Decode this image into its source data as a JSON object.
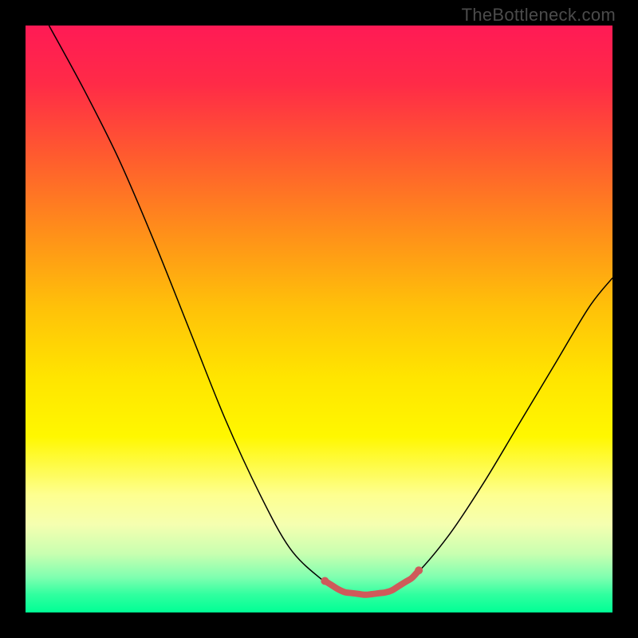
{
  "watermark": "TheBottleneck.com",
  "chart_data": {
    "type": "line",
    "title": "",
    "xlabel": "",
    "ylabel": "",
    "xlim": [
      0,
      1
    ],
    "ylim": [
      0,
      1
    ],
    "series": [
      {
        "name": "bottleneck-curve",
        "points": [
          {
            "x": 0.04,
            "y": 1.0
          },
          {
            "x": 0.1,
            "y": 0.89
          },
          {
            "x": 0.16,
            "y": 0.77
          },
          {
            "x": 0.22,
            "y": 0.63
          },
          {
            "x": 0.28,
            "y": 0.48
          },
          {
            "x": 0.34,
            "y": 0.33
          },
          {
            "x": 0.4,
            "y": 0.2
          },
          {
            "x": 0.45,
            "y": 0.11
          },
          {
            "x": 0.5,
            "y": 0.06
          },
          {
            "x": 0.54,
            "y": 0.035
          },
          {
            "x": 0.58,
            "y": 0.03
          },
          {
            "x": 0.62,
            "y": 0.035
          },
          {
            "x": 0.66,
            "y": 0.06
          },
          {
            "x": 0.72,
            "y": 0.13
          },
          {
            "x": 0.78,
            "y": 0.22
          },
          {
            "x": 0.84,
            "y": 0.32
          },
          {
            "x": 0.9,
            "y": 0.42
          },
          {
            "x": 0.96,
            "y": 0.52
          },
          {
            "x": 1.0,
            "y": 0.57
          }
        ]
      }
    ],
    "highlight": {
      "name": "optimal-range",
      "x_start": 0.51,
      "x_end": 0.67,
      "dot_xs": [
        0.51,
        0.67
      ]
    },
    "background_gradient": {
      "stops": [
        {
          "pos": 0.0,
          "color": "#ff1a55"
        },
        {
          "pos": 0.5,
          "color": "#ffd400"
        },
        {
          "pos": 0.85,
          "color": "#f5ffb0"
        },
        {
          "pos": 1.0,
          "color": "#00ff95"
        }
      ]
    }
  }
}
